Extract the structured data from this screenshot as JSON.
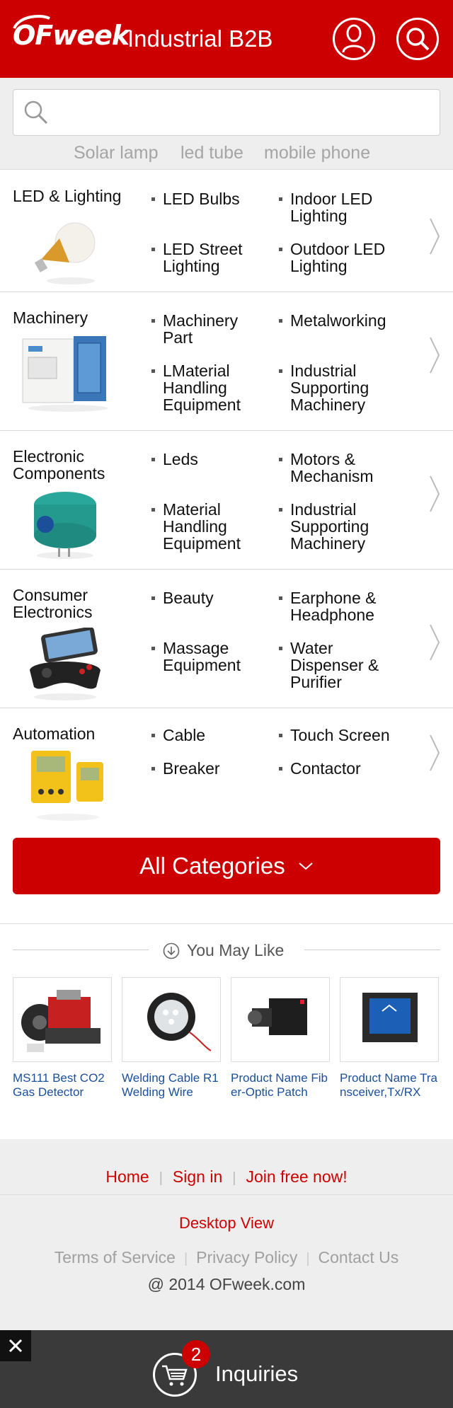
{
  "header": {
    "logo_text": "OFweek",
    "title": "Industrial B2B",
    "user_icon": "user-icon",
    "search_icon": "search-icon",
    "brand_color": "#cc0000"
  },
  "search": {
    "placeholder": "",
    "hot_words": [
      "Solar lamp",
      "led tube",
      "mobile phone"
    ]
  },
  "categories": [
    {
      "name": "LED & Lighting",
      "image": "light-bulb",
      "subs": [
        "LED Bulbs",
        "Indoor LED Lighting",
        "LED Street Lighting",
        "Outdoor LED Lighting"
      ]
    },
    {
      "name": "Machinery",
      "image": "oven-machine",
      "subs": [
        "Machinery Part",
        "Metalworking",
        "LMaterial Handling Equipment",
        "Industrial Supporting Machinery"
      ]
    },
    {
      "name": "Electronic Components",
      "image": "gas-sensor",
      "subs": [
        "Leds",
        "Motors & Mechanism",
        "Material Handling Equipment",
        "Industrial Supporting Machinery"
      ]
    },
    {
      "name": "Consumer Electronics",
      "image": "game-controller",
      "subs": [
        "Beauty",
        "Earphone & Headphone",
        "Massage Equipment",
        "Water Dispenser & Purifier"
      ]
    },
    {
      "name": "Automation",
      "image": "meters",
      "subs": [
        "Cable",
        "Touch Screen",
        "Breaker",
        "Contactor"
      ]
    }
  ],
  "all_categories": {
    "label": "All Categories"
  },
  "you_may_like": {
    "title": "You May Like",
    "products": [
      {
        "name": "MS111 Best CO2 Gas Detector",
        "image": "engine"
      },
      {
        "name": "Welding Cable R1 Welding Wire",
        "image": "work-light"
      },
      {
        "name": "Product Name Fiber-Optic Patch",
        "image": "camera"
      },
      {
        "name": "Product Name Transceiver,Tx/RX",
        "image": "monitor"
      }
    ]
  },
  "footer": {
    "links": [
      "Home",
      "Sign in",
      "Join free now!"
    ],
    "desktop_view": "Desktop View",
    "legal": [
      "Terms of Service",
      "Privacy Policy",
      "Contact Us"
    ],
    "copyright": "@ 2014 OFweek.com"
  },
  "inquiry_bar": {
    "count": "2",
    "label": "Inquiries",
    "close_icon": "close-icon",
    "cart_icon": "cart-icon"
  }
}
